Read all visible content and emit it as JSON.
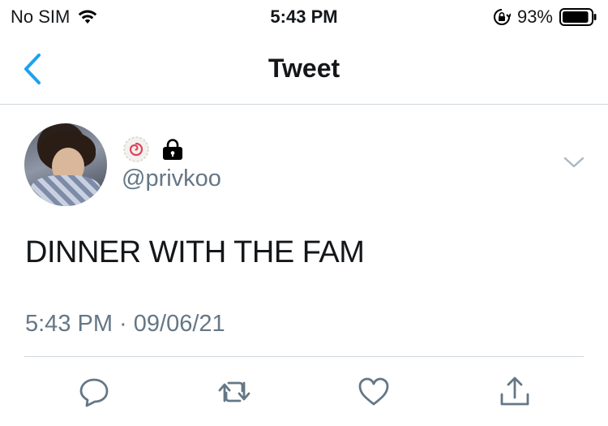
{
  "status_bar": {
    "carrier": "No SIM",
    "time": "5:43 PM",
    "battery_percent": "93%",
    "battery_level": 0.93
  },
  "nav": {
    "title": "Tweet",
    "back_icon": "chevron-left-icon"
  },
  "tweet": {
    "handle": "@privkoo",
    "text": "DINNER WITH THE FAM",
    "timestamp": "5:43 PM · 09/06/21",
    "badge_icon": "swirl-emoji-icon",
    "locked_icon": "lock-icon"
  },
  "actions": [
    "reply-icon",
    "retweet-icon",
    "like-icon",
    "share-icon"
  ],
  "colors": {
    "accent": "#1da1f2",
    "secondary_text": "#657786",
    "divider": "#cfd6dc"
  }
}
